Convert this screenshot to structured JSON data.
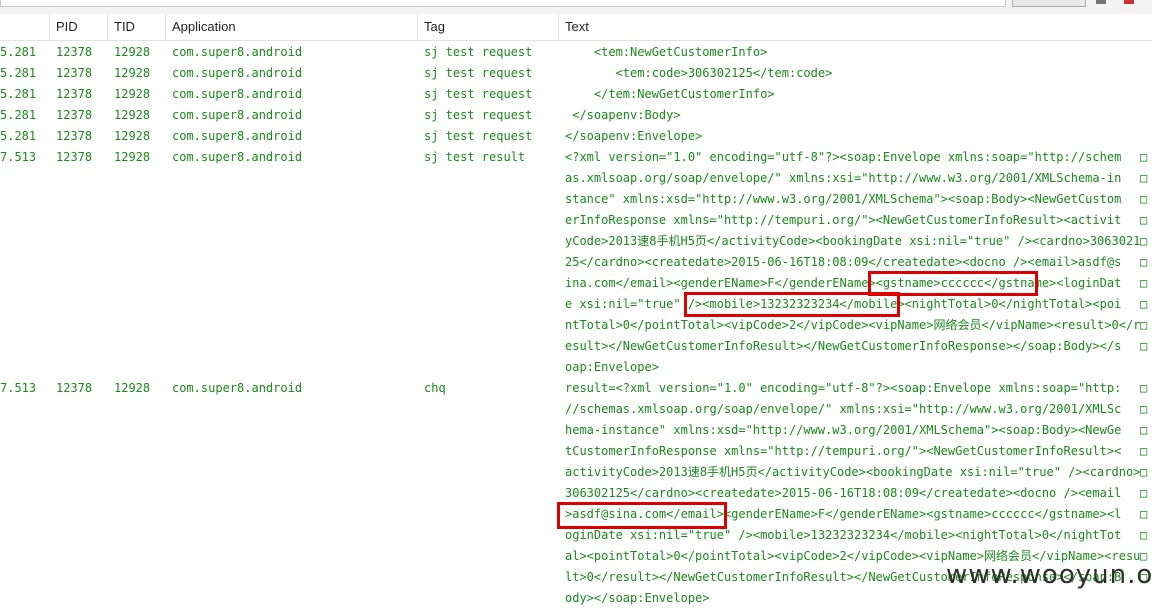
{
  "columns": {
    "pid": "PID",
    "tid": "TID",
    "application": "Application",
    "tag": "Tag",
    "text": "Text"
  },
  "rows": [
    {
      "time": "5.281",
      "pid": "12378",
      "tid": "12928",
      "app": "com.super8.android",
      "tag": "sj test request",
      "text": "    <tem:NewGetCustomerInfo>"
    },
    {
      "time": "5.281",
      "pid": "12378",
      "tid": "12928",
      "app": "com.super8.android",
      "tag": "sj test request",
      "text": "       <tem:code>306302125</tem:code>"
    },
    {
      "time": "5.281",
      "pid": "12378",
      "tid": "12928",
      "app": "com.super8.android",
      "tag": "sj test request",
      "text": "    </tem:NewGetCustomerInfo>"
    },
    {
      "time": "5.281",
      "pid": "12378",
      "tid": "12928",
      "app": "com.super8.android",
      "tag": "sj test request",
      "text": " </soapenv:Body>"
    },
    {
      "time": "5.281",
      "pid": "12378",
      "tid": "12928",
      "app": "com.super8.android",
      "tag": "sj test request",
      "text": "</soapenv:Envelope>"
    },
    {
      "time": "7.513",
      "pid": "12378",
      "tid": "12928",
      "app": "com.super8.android",
      "tag": "sj test result",
      "text": "<?xml version=\"1.0\" encoding=\"utf-8\"?><soap:Envelope xmlns:soap=\"http://schem",
      "mark": "□"
    },
    {
      "time": "",
      "pid": "",
      "tid": "",
      "app": "",
      "tag": "",
      "text": "as.xmlsoap.org/soap/envelope/\" xmlns:xsi=\"http://www.w3.org/2001/XMLSchema-in",
      "mark": "□"
    },
    {
      "time": "",
      "pid": "",
      "tid": "",
      "app": "",
      "tag": "",
      "text": "stance\" xmlns:xsd=\"http://www.w3.org/2001/XMLSchema\"><soap:Body><NewGetCustom",
      "mark": "□"
    },
    {
      "time": "",
      "pid": "",
      "tid": "",
      "app": "",
      "tag": "",
      "text": "erInfoResponse xmlns=\"http://tempuri.org/\"><NewGetCustomerInfoResult><activit",
      "mark": "□"
    },
    {
      "time": "",
      "pid": "",
      "tid": "",
      "app": "",
      "tag": "",
      "text": "yCode>2013速8手机H5页</activityCode><bookingDate xsi:nil=\"true\" /><cardno>3063021",
      "mark": "□"
    },
    {
      "time": "",
      "pid": "",
      "tid": "",
      "app": "",
      "tag": "",
      "text": "25</cardno><createdate>2015-06-16T18:08:09</createdate><docno /><email>asdf@s",
      "mark": "□"
    },
    {
      "time": "",
      "pid": "",
      "tid": "",
      "app": "",
      "tag": "",
      "text": "ina.com</email><genderEName>F</genderEName><gstname>cccccc</gstname><loginDat",
      "mark": "□"
    },
    {
      "time": "",
      "pid": "",
      "tid": "",
      "app": "",
      "tag": "",
      "text": "e xsi:nil=\"true\" /><mobile>13232323234</mobile><nightTotal>0</nightTotal><poi",
      "mark": "□"
    },
    {
      "time": "",
      "pid": "",
      "tid": "",
      "app": "",
      "tag": "",
      "text": "ntTotal>0</pointTotal><vipCode>2</vipCode><vipName>网络会员</vipName><result>0</r",
      "mark": "□"
    },
    {
      "time": "",
      "pid": "",
      "tid": "",
      "app": "",
      "tag": "",
      "text": "esult></NewGetCustomerInfoResult></NewGetCustomerInfoResponse></soap:Body></s",
      "mark": "□"
    },
    {
      "time": "",
      "pid": "",
      "tid": "",
      "app": "",
      "tag": "",
      "text": "oap:Envelope>"
    },
    {
      "time": "7.513",
      "pid": "12378",
      "tid": "12928",
      "app": "com.super8.android",
      "tag": "chq",
      "text": "result=<?xml version=\"1.0\" encoding=\"utf-8\"?><soap:Envelope xmlns:soap=\"http:",
      "mark": "□"
    },
    {
      "time": "",
      "pid": "",
      "tid": "",
      "app": "",
      "tag": "",
      "text": "//schemas.xmlsoap.org/soap/envelope/\" xmlns:xsi=\"http://www.w3.org/2001/XMLSc",
      "mark": "□"
    },
    {
      "time": "",
      "pid": "",
      "tid": "",
      "app": "",
      "tag": "",
      "text": "hema-instance\" xmlns:xsd=\"http://www.w3.org/2001/XMLSchema\"><soap:Body><NewGe",
      "mark": "□"
    },
    {
      "time": "",
      "pid": "",
      "tid": "",
      "app": "",
      "tag": "",
      "text": "tCustomerInfoResponse xmlns=\"http://tempuri.org/\"><NewGetCustomerInfoResult><",
      "mark": "□"
    },
    {
      "time": "",
      "pid": "",
      "tid": "",
      "app": "",
      "tag": "",
      "text": "activityCode>2013速8手机H5页</activityCode><bookingDate xsi:nil=\"true\" /><cardno>",
      "mark": "□"
    },
    {
      "time": "",
      "pid": "",
      "tid": "",
      "app": "",
      "tag": "",
      "text": "306302125</cardno><createdate>2015-06-16T18:08:09</createdate><docno /><email",
      "mark": "□"
    },
    {
      "time": "",
      "pid": "",
      "tid": "",
      "app": "",
      "tag": "",
      "text": ">asdf@sina.com</email><genderEName>F</genderEName><gstname>cccccc</gstname><l",
      "mark": "□"
    },
    {
      "time": "",
      "pid": "",
      "tid": "",
      "app": "",
      "tag": "",
      "text": "oginDate xsi:nil=\"true\" /><mobile>13232323234</mobile><nightTotal>0</nightTot",
      "mark": "□"
    },
    {
      "time": "",
      "pid": "",
      "tid": "",
      "app": "",
      "tag": "",
      "text": "al><pointTotal>0</pointTotal><vipCode>2</vipCode><vipName>网络会员</vipName><resu",
      "mark": "□"
    },
    {
      "time": "",
      "pid": "",
      "tid": "",
      "app": "",
      "tag": "",
      "text": "lt>0</result></NewGetCustomerInfoResult></NewGetCustomerInfoResponse></soap:B",
      "mark": "□"
    },
    {
      "time": "",
      "pid": "",
      "tid": "",
      "app": "",
      "tag": "",
      "text": "ody></soap:Envelope>"
    }
  ],
  "watermark": "www.wooyun.org",
  "colors": {
    "log_text": "#1a8a1a",
    "highlight": "#dd0000"
  }
}
